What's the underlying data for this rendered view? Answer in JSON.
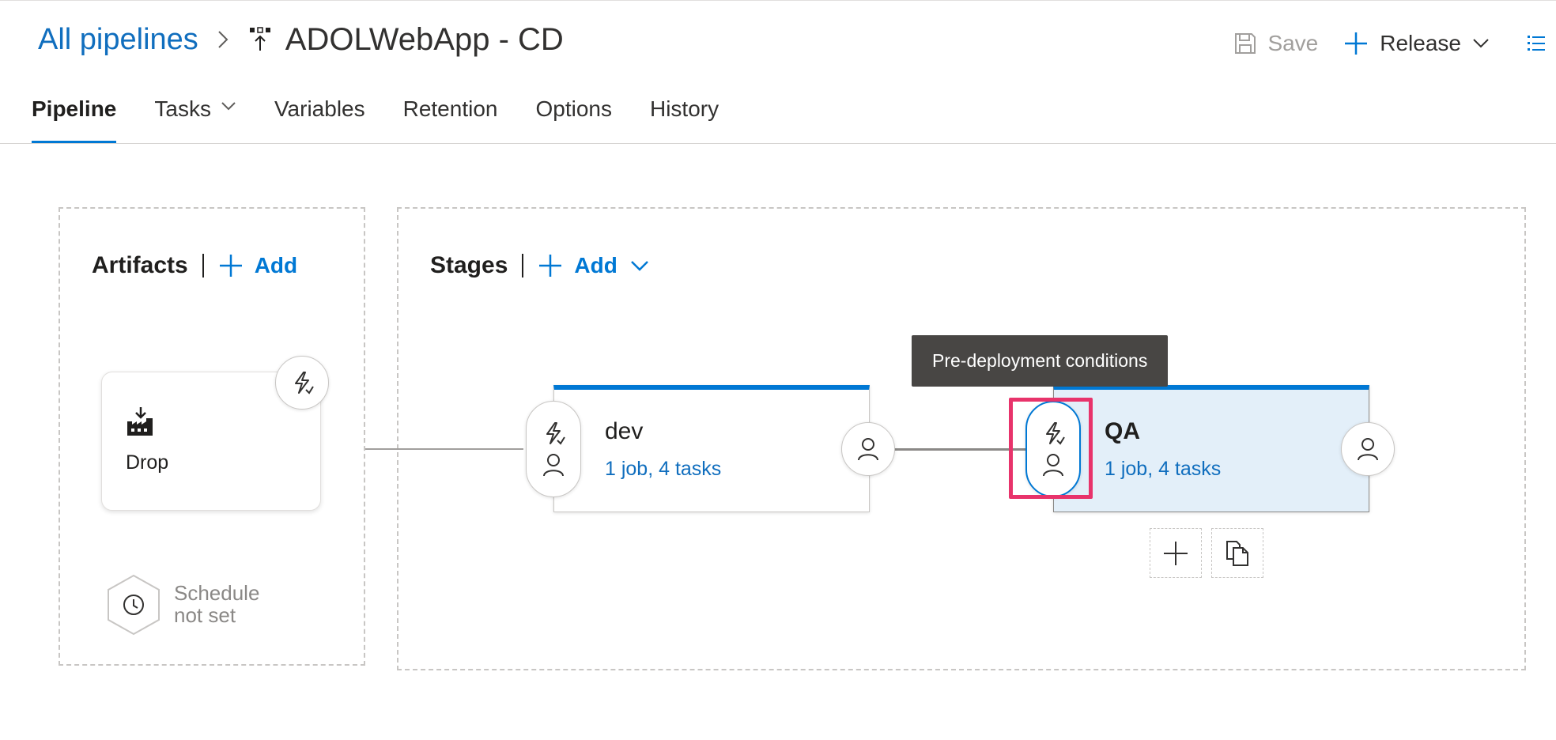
{
  "breadcrumb": {
    "all_pipelines": "All pipelines",
    "pipeline_name": "ADOLWebApp - CD"
  },
  "commands": {
    "save_label": "Save",
    "release_label": "Release"
  },
  "tabs": [
    {
      "label": "Pipeline",
      "active": true
    },
    {
      "label": "Tasks",
      "has_dropdown": true
    },
    {
      "label": "Variables"
    },
    {
      "label": "Retention"
    },
    {
      "label": "Options"
    },
    {
      "label": "History"
    }
  ],
  "artifacts": {
    "title": "Artifacts",
    "add_label": "Add",
    "items": [
      {
        "name": "Drop"
      }
    ],
    "schedule_line1": "Schedule",
    "schedule_line2": "not set"
  },
  "stages": {
    "title": "Stages",
    "add_label": "Add",
    "items": [
      {
        "name": "dev",
        "summary": "1 job, 4 tasks",
        "selected": false
      },
      {
        "name": "QA",
        "summary": "1 job, 4 tasks",
        "selected": true
      }
    ]
  },
  "tooltip": {
    "text": "Pre-deployment conditions"
  },
  "colors": {
    "accent": "#0078d4",
    "link": "#106ebe",
    "highlight": "#e8336b",
    "selected_stage_bg": "#e3eff9",
    "tooltip_bg": "#484644"
  }
}
